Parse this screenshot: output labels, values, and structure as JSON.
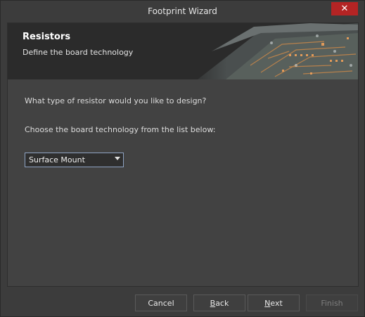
{
  "window": {
    "title": "Footprint Wizard",
    "close_symbol": "✕"
  },
  "banner": {
    "title": "Resistors",
    "subtitle": "Define the board technology"
  },
  "main": {
    "question": "What type of resistor would you like to design?",
    "prompt": "Choose the board technology from the list below:",
    "technology_select": {
      "value": "Surface Mount"
    }
  },
  "buttons": {
    "cancel": "Cancel",
    "back_mnemonic": "B",
    "back_rest": "ack",
    "next_mnemonic": "N",
    "next_rest": "ext",
    "finish": "Finish"
  },
  "colors": {
    "close_button": "#b42424",
    "dropdown_border": "#8fa4c4",
    "banner_bg": "#2b2b2b"
  }
}
